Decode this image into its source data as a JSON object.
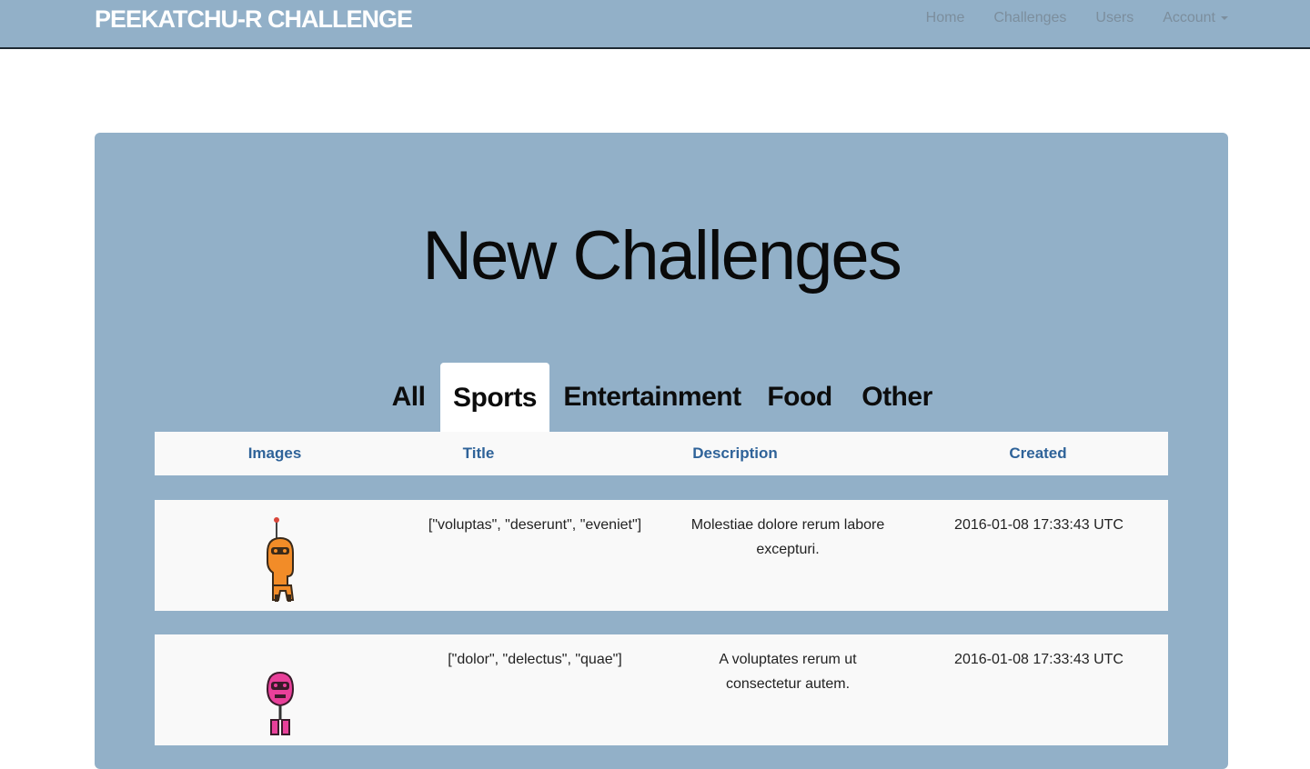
{
  "navbar": {
    "brand": "PEEKATCHU-R CHALLENGE",
    "links": [
      "Home",
      "Challenges",
      "Users",
      "Account"
    ]
  },
  "main": {
    "title": "New Challenges",
    "tabs": [
      {
        "label": "All",
        "active": false
      },
      {
        "label": "Sports",
        "active": true
      },
      {
        "label": "Entertainment",
        "active": false
      },
      {
        "label": "Food",
        "active": false
      },
      {
        "label": "Other",
        "active": false
      }
    ],
    "table": {
      "headers": [
        "Images",
        "Title",
        "Description",
        "Created"
      ],
      "rows": [
        {
          "image": "orange-robot-icon",
          "title": "[\"voluptas\", \"deserunt\", \"eveniet\"]",
          "description": "Molestiae dolore rerum labore excepturi.",
          "created": "2016-01-08 17:33:43 UTC"
        },
        {
          "image": "pink-robot-icon",
          "title": "[\"dolor\", \"delectus\", \"quae\"]",
          "description": "A voluptates rerum ut consectetur autem.",
          "created": "2016-01-08 17:33:43 UTC"
        }
      ]
    }
  },
  "colors": {
    "navbar_bg": "#92b0c8",
    "panel_bg": "#92b0c8",
    "header_link": "#2f6399",
    "robot_orange": "#f28c28",
    "robot_pink": "#e8409a"
  }
}
